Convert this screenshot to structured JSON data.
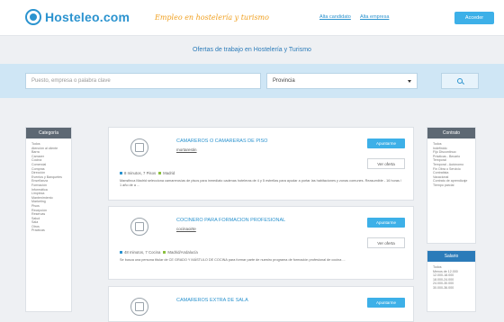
{
  "header": {
    "logo_text": "Hosteleo.com",
    "tagline": "Empleo en hostelería y turismo",
    "nav_candidate": "Alta candidato",
    "nav_company": "Alta empresa",
    "login": "Acceder"
  },
  "page_title": "Ofertas de trabajo en Hostelería y Turismo",
  "search": {
    "placeholder": "Puesto, empresa o palabra clave",
    "province": "Provincia"
  },
  "categories": {
    "title": "Categoría",
    "items": [
      "Todos",
      "Atención al cliente",
      "Barra",
      "Camarer",
      "Cocina",
      "Comercial",
      "Compras",
      "Dirección",
      "Eventos y Banquetes",
      "Enseñanza",
      "Formación",
      "Informática",
      "Limpieza",
      "Mantenimiento",
      "Marketing",
      "Pisos",
      "Recepción",
      "Reservas",
      "Salud",
      "Sala",
      "Otros",
      "Practicas"
    ]
  },
  "contract": {
    "title": "Contrato",
    "items": [
      "Todos",
      "Indefinido",
      "Fijo Discontinuo",
      "Prácticas - Becario",
      "Temporal",
      "Temporal - Autónomo",
      "Fin Obra o Servicio",
      "Contratista",
      "Vacacional",
      "Contrato de aprendizaje",
      "Tiempo parcial"
    ]
  },
  "salary": {
    "title": "Salario",
    "items": [
      "Todos",
      "Menos de 12.000",
      "12.000-18.000",
      "18.000-24.000",
      "24.000-30.000",
      "30.000-36.000"
    ]
  },
  "jobs": [
    {
      "title": "CAMAREROS O CAMARERAS DE PISO",
      "company": "mortarestin",
      "meta_left": "8 minutos, 7 Pisos",
      "meta_right": "Madrid",
      "description": "Mansfinca Madrid selecciona camareros/as de pisos para inmediato cadenas hoteleras de 4 y 5 estrellas para ayudar a portar las habitaciones y zonas comunes. Reasumible - 16 horas / 1 año de a ...",
      "apply": "Apuntarme",
      "view": "Ver oferta"
    },
    {
      "title": "COCINERO PARA FORMACION PROFESIONAL",
      "company": "cocinaoirte",
      "meta_left": "48 minutos, 7 Cocina",
      "meta_right": "Madrid/Andalucía",
      "description": "Se busca una persona titular de CE GRADO Y MÁSTULO DE COCINA para formar parte de nuestro programa de formación profesional de cocina ...",
      "apply": "Apuntarme",
      "view": "Ver oferta"
    },
    {
      "title": "CAMAREROS EXTRA DE SALA",
      "company": "",
      "apply": "Apuntarme"
    }
  ]
}
